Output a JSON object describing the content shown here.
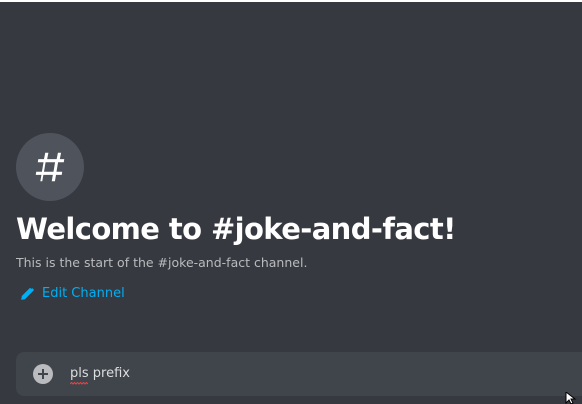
{
  "channel": {
    "icon": "hash-icon",
    "welcome_title": "Welcome to #joke-and-fact!",
    "welcome_subtitle": "This is the start of the #joke-and-fact channel."
  },
  "actions": {
    "edit_channel_label": "Edit Channel",
    "edit_icon": "pencil-icon"
  },
  "composer": {
    "attach_icon": "plus-circle-icon",
    "input_value": "pls prefix"
  },
  "colors": {
    "background": "#36393f",
    "composer": "#40444b",
    "link": "#00aff4",
    "title": "#ffffff",
    "subtitle": "#b9bbbe"
  }
}
